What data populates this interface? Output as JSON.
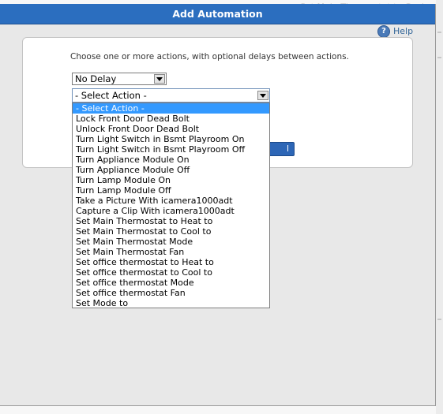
{
  "background": {
    "text": "Set Main Thermostat to Cool"
  },
  "dialog": {
    "title": "Add Automation",
    "help_label": "Help",
    "help_icon": "question-mark-icon",
    "title_color": "#2b6ebf"
  },
  "form": {
    "instruction": "Choose one or more actions, with optional delays between actions.",
    "delay_select": {
      "value": "No Delay"
    },
    "action_select": {
      "value": "- Select Action -",
      "options": [
        "- Select Action -",
        "Lock Front Door Dead Bolt",
        "Unlock Front Door Dead Bolt",
        "Turn Light Switch in Bsmt Playroom On",
        "Turn Light Switch in Bsmt Playroom Off",
        "Turn Appliance Module On",
        "Turn Appliance Module Off",
        "Turn Lamp Module On",
        "Turn Lamp Module Off",
        "Take a Picture With icamera1000adt",
        "Capture a Clip With icamera1000adt",
        "Set Main Thermostat to Heat to",
        "Set Main Thermostat to Cool to",
        "Set Main Thermostat Mode",
        "Set Main Thermostat Fan",
        "Set office thermostat to Heat to",
        "Set office thermostat to Cool to",
        "Set office thermostat Mode",
        "Set office thermostat Fan",
        "Set Mode to"
      ],
      "highlighted_index": 0,
      "highlight_color": "#3399ff"
    },
    "ok_button_label": "l"
  }
}
